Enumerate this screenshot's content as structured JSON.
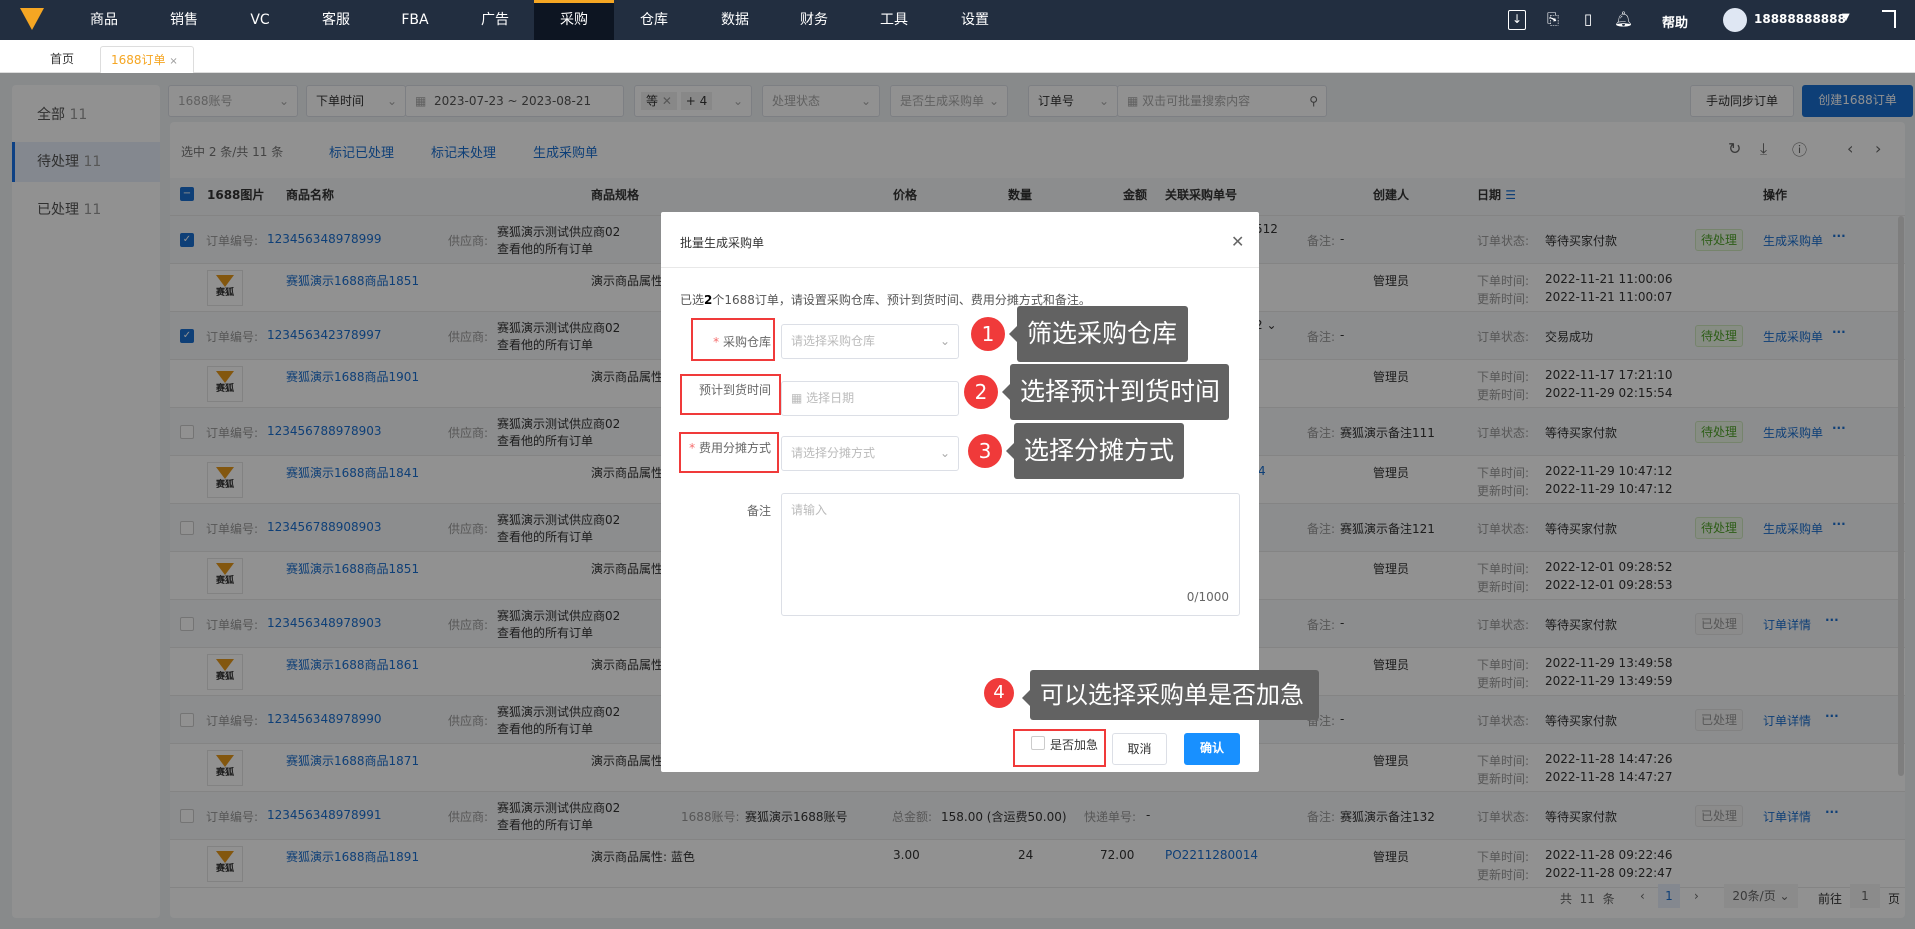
{
  "nav": {
    "items": [
      "商品",
      "销售",
      "VC",
      "客服",
      "FBA",
      "广告",
      "采购",
      "仓库",
      "数据",
      "财务",
      "工具",
      "设置"
    ],
    "active": "采购",
    "help": "帮助",
    "user": "18888888888"
  },
  "tabs": {
    "home": "首页",
    "current": "1688订单",
    "close": "×"
  },
  "sidebar": {
    "items": [
      {
        "label": "全部",
        "count": "11"
      },
      {
        "label": "待处理",
        "count": "11"
      },
      {
        "label": "已处理",
        "count": "11"
      }
    ]
  },
  "filters": {
    "account": "1688账号",
    "time_type": "下单时间",
    "date_range": "2023-07-23 ~ 2023-08-21",
    "tag1": "等",
    "tag_more": "+ 4",
    "status": "处理状态",
    "generated": "是否生成采购单",
    "search_type": "订单号",
    "search_placeholder": "双击可批量搜索内容",
    "sync_button": "手动同步订单",
    "create_button": "创建1688订单"
  },
  "toolbar": {
    "selection": "选中 2 条/共 11 条",
    "mark_done": "标记已处理",
    "mark_undone": "标记未处理",
    "generate": "生成采购单"
  },
  "table": {
    "headers": {
      "image": "1688图片",
      "name": "商品名称",
      "spec": "商品规格",
      "price": "价格",
      "qty": "数量",
      "amount": "金额",
      "po": "关联采购单号",
      "creator": "创建人",
      "date": "日期",
      "action": "操作"
    },
    "labels": {
      "order_no": "订单编号:",
      "supplier": "供应商:",
      "view_all": "查看他的所有订单",
      "remark": "备注:",
      "status": "订单状态:",
      "order_time": "下单时间:",
      "update_time": "更新时间:",
      "account": "1688账号:",
      "total": "总金额:",
      "express": "快递单号:",
      "more": "···",
      "thumb": "赛狐"
    },
    "orders": [
      {
        "order_no": "123456348978999",
        "checked": true,
        "supplier": "赛狐演示测试供应商02",
        "frag": "512",
        "remark": "-",
        "status": "等待买家付款",
        "tag": "待处理",
        "tag_type": "pending",
        "action": "生成采购单",
        "product": "赛狐演示1688商品1851",
        "spec": "演示商品属性",
        "creator": "管理员",
        "order_time": "2022-11-21 11:00:06",
        "update_time": "2022-11-21 11:00:07"
      },
      {
        "order_no": "123456342378997",
        "checked": true,
        "supplier": "赛狐演示测试供应商02",
        "frag": "2 ⌄",
        "remark": "-",
        "status": "交易成功",
        "tag": "待处理",
        "tag_type": "pending",
        "action": "生成采购单",
        "product": "赛狐演示1688商品1901",
        "spec": "演示商品属性",
        "creator": "管理员",
        "order_time": "2022-11-17 17:21:10",
        "update_time": "2022-11-29 02:15:54"
      },
      {
        "order_no": "123456788978903",
        "checked": false,
        "supplier": "赛狐演示测试供应商02",
        "remark": "赛狐演示备注111",
        "status": "等待买家付款",
        "tag": "待处理",
        "tag_type": "pending",
        "action": "生成采购单",
        "product": "赛狐演示1688商品1841",
        "spec": "演示商品属性",
        "pfrag": "4",
        "creator": "管理员",
        "order_time": "2022-11-29 10:47:12",
        "update_time": "2022-11-29 10:47:12"
      },
      {
        "order_no": "123456788908903",
        "checked": false,
        "supplier": "赛狐演示测试供应商02",
        "remark": "赛狐演示备注121",
        "status": "等待买家付款",
        "tag": "待处理",
        "tag_type": "pending",
        "action": "生成采购单",
        "product": "赛狐演示1688商品1851",
        "spec": "演示商品属性",
        "creator": "管理员",
        "order_time": "2022-12-01 09:28:52",
        "update_time": "2022-12-01 09:28:53"
      },
      {
        "order_no": "123456348978903",
        "checked": false,
        "supplier": "赛狐演示测试供应商02",
        "remark": "-",
        "status": "等待买家付款",
        "tag": "已处理",
        "tag_type": "done",
        "action": "订单详情",
        "product": "赛狐演示1688商品1861",
        "spec": "演示商品属性",
        "creator": "管理员",
        "order_time": "2022-11-29 13:49:58",
        "update_time": "2022-11-29 13:49:59"
      },
      {
        "order_no": "123456348978990",
        "checked": false,
        "supplier": "赛狐演示测试供应商02",
        "remark": "-",
        "status": "等待买家付款",
        "tag": "已处理",
        "tag_type": "done",
        "action": "订单详情",
        "product": "赛狐演示1688商品1871",
        "spec": "演示商品属性",
        "creator": "管理员",
        "order_time": "2022-11-28 14:47:26",
        "update_time": "2022-11-28 14:47:27"
      },
      {
        "order_no": "123456348978991",
        "checked": false,
        "supplier": "赛狐演示测试供应商02",
        "account": "赛狐演示1688账号",
        "total": "158.00 (含运费50.00)",
        "express": "-",
        "remark": "赛狐演示备注132",
        "status": "等待买家付款",
        "tag": "已处理",
        "tag_type": "done",
        "action": "订单详情",
        "product": "赛狐演示1688商品1891",
        "spec": "演示商品属性: 蓝色",
        "price": "3.00",
        "qty": "24",
        "amount": "72.00",
        "po": "PO2211280014",
        "creator": "管理员",
        "order_time": "2022-11-28 09:22:46",
        "update_time": "2022-11-28 09:22:47"
      }
    ]
  },
  "pagination": {
    "total_prefix": "共",
    "total": "11",
    "total_suffix": "条",
    "page": "1",
    "page_size": "20条/页",
    "goto": "前往",
    "goto_value": "1",
    "page_suffix": "页"
  },
  "dialog": {
    "title": "批量生成采购单",
    "intro_pre": "已选",
    "intro_count": "2",
    "intro_post": "个1688订单，请设置采购仓库、预计到货时间、费用分摊方式和备注。",
    "warehouse_label": "采购仓库",
    "warehouse_placeholder": "请选择采购仓库",
    "arrival_label": "预计到货时间",
    "arrival_placeholder": "选择日期",
    "alloc_label": "费用分摊方式",
    "alloc_placeholder": "请选择分摊方式",
    "remark_label": "备注",
    "remark_placeholder": "请输入",
    "remark_count": "0/1000",
    "urgent_label": "是否加急",
    "cancel": "取消",
    "confirm": "确认",
    "required_mark": "*"
  },
  "callouts": [
    {
      "num": "1",
      "text": "筛选采购仓库"
    },
    {
      "num": "2",
      "text": "选择预计到货时间"
    },
    {
      "num": "3",
      "text": "选择分摊方式"
    },
    {
      "num": "4",
      "text": "可以选择采购单是否加急"
    }
  ],
  "colors": {
    "nav_bg": "#222e40",
    "accent": "#f5a623",
    "primary": "#1a6fd1",
    "confirm": "#1890ff",
    "annotation_red": "#f03a3a"
  }
}
